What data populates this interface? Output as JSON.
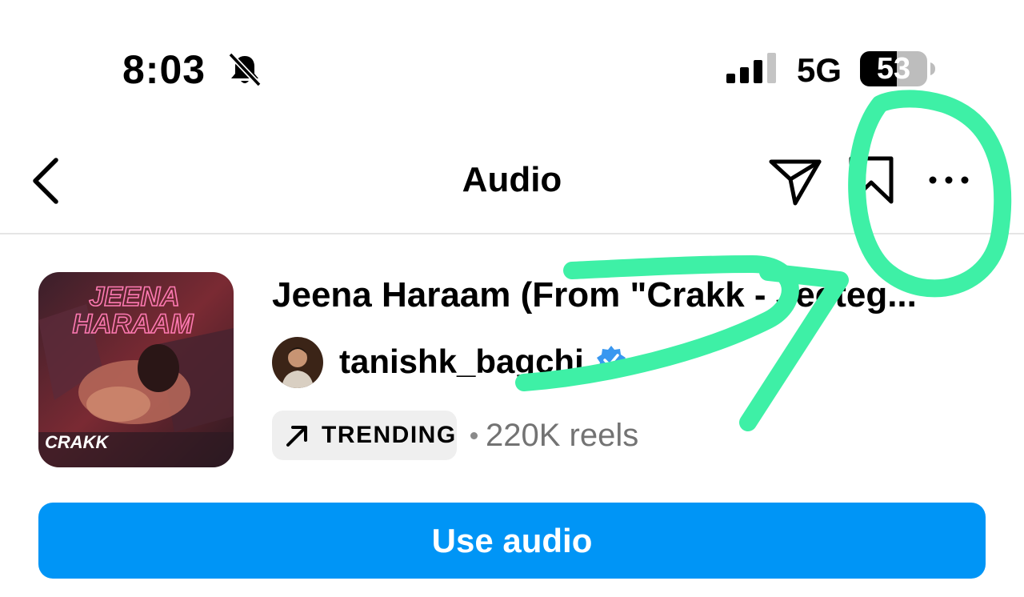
{
  "status_bar": {
    "time": "8:03",
    "network": "5G",
    "battery": "53"
  },
  "nav": {
    "title": "Audio",
    "icons": [
      "back-chevron-icon",
      "send-icon",
      "bookmark-icon",
      "more-icon"
    ]
  },
  "audio": {
    "title": "Jeena Haraam (From \"Crakk - Jeeteg...",
    "artist": "tanishk_bagchi",
    "verified": true,
    "trending_label": "TRENDING",
    "reels_count": "220K reels"
  },
  "album_art": {
    "headline": "JEENA HARAAM",
    "movie_logo": "CRAKK"
  },
  "actions": {
    "use_audio_label": "Use audio"
  },
  "colors": {
    "accent_blue": "#0095f6",
    "highlight_green": "#3ef0a6",
    "verified_blue": "#3897f0"
  }
}
